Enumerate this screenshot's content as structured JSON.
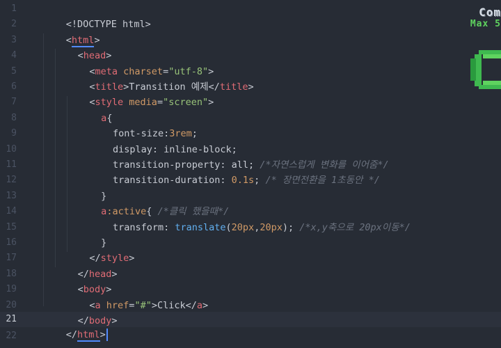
{
  "editor": {
    "active_line": 21,
    "line_numbers": [
      "1",
      "2",
      "3",
      "4",
      "5",
      "6",
      "7",
      "8",
      "9",
      "10",
      "11",
      "12",
      "13",
      "14",
      "15",
      "16",
      "17",
      "18",
      "19",
      "20",
      "21",
      "22"
    ]
  },
  "overlay": {
    "combo_text": "Com",
    "max_text": "Max 5"
  },
  "colors": {
    "background": "#272c35",
    "tag": "#e06c75",
    "attribute": "#d19a66",
    "string": "#98c379",
    "function": "#61afef",
    "comment": "#6b727f",
    "cursor": "#528bff",
    "overlay_green": "#5fd35f"
  },
  "code": {
    "l1_doctype": "<!DOCTYPE html>",
    "l2_open": "<",
    "l2_tag": "html",
    "l2_close": ">",
    "l3_open": "<",
    "l3_tag": "head",
    "l3_close": ">",
    "l4_open": "<",
    "l4_tag": "meta",
    "l4_attr": " charset",
    "l4_eq": "=",
    "l4_val": "\"utf-8\"",
    "l4_close": ">",
    "l5_open": "<",
    "l5_tag": "title",
    "l5_close": ">",
    "l5_text": "Transition 예제",
    "l5_end_open": "</",
    "l5_end_tag": "title",
    "l5_end_close": ">",
    "l6_open": "<",
    "l6_tag": "style",
    "l6_attr": " media",
    "l6_eq": "=",
    "l6_val": "\"screen\"",
    "l6_close": ">",
    "l7_sel": "a",
    "l7_brace": "{",
    "l8_prop": "font-size:",
    "l8_val": "3rem",
    "l8_semi": ";",
    "l9_prop": "display: ",
    "l9_val": "inline-block;",
    "l10_prop": "transition-property: ",
    "l10_val": "all; ",
    "l10_cmt": "/*자연스럽게 변화를 이어줌*/",
    "l11_prop": "transition-duration: ",
    "l11_num": "0.1s",
    "l11_semi": "; ",
    "l11_cmt": "/* 장면전환을 1초동안 */",
    "l12_brace": "}",
    "l13_sel": "a",
    "l13_pseudo": ":active",
    "l13_brace": "{ ",
    "l13_cmt": "/*클릭 했을때*/",
    "l14_prop": "transform: ",
    "l14_fn": "translate",
    "l14_p1": "(",
    "l14_n1": "20px",
    "l14_comma": ",",
    "l14_n2": "20px",
    "l14_p2": "); ",
    "l14_cmt": "/*x,y축으로 20px이동*/",
    "l15_brace": "}",
    "l16_open": "</",
    "l16_tag": "style",
    "l16_close": ">",
    "l17_open": "</",
    "l17_tag": "head",
    "l17_close": ">",
    "l18_open": "<",
    "l18_tag": "body",
    "l18_close": ">",
    "l19_open": "<",
    "l19_tag": "a",
    "l19_attr": " href",
    "l19_eq": "=",
    "l19_val": "\"#\"",
    "l19_close": ">",
    "l19_text": "Click",
    "l19_end_open": "</",
    "l19_end_tag": "a",
    "l19_end_close": ">",
    "l20_open": "</",
    "l20_tag": "body",
    "l20_close": ">",
    "l21_open": "</",
    "l21_tag": "html",
    "l21_close": ">"
  }
}
